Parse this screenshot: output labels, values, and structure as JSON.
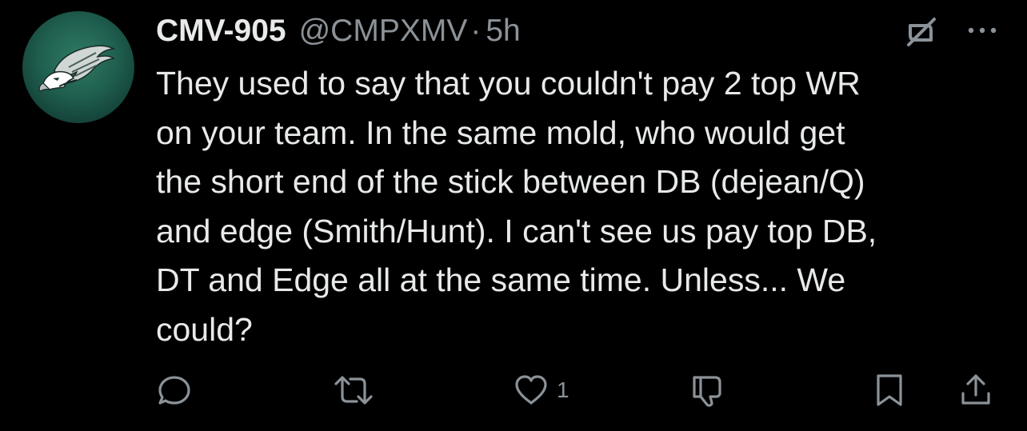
{
  "tweet": {
    "display_name": "CMV-905",
    "handle": "@CMPXMV",
    "separator": "·",
    "time": "5h",
    "text": "They used to say that you couldn't pay 2 top WR\non your team. In the same mold, who would get\nthe short end of the stick between DB (dejean/Q)\nand edge (Smith/Hunt). I can't see us pay top DB,\nDT and Edge all at the same time. Unless... We\ncould?",
    "avatar_icon": "eagle-logo-icon"
  },
  "actions": {
    "reply_icon": "reply-icon",
    "retweet_icon": "retweet-icon",
    "like_icon": "heart-icon",
    "like_count": "1",
    "dislike_icon": "thumbs-down-icon",
    "bookmark_icon": "bookmark-icon",
    "share_icon": "share-icon"
  },
  "colors": {
    "background": "#000000",
    "text": "#e7e9ea",
    "secondary": "#8b9298",
    "avatar_green": "#1f5f4f"
  }
}
